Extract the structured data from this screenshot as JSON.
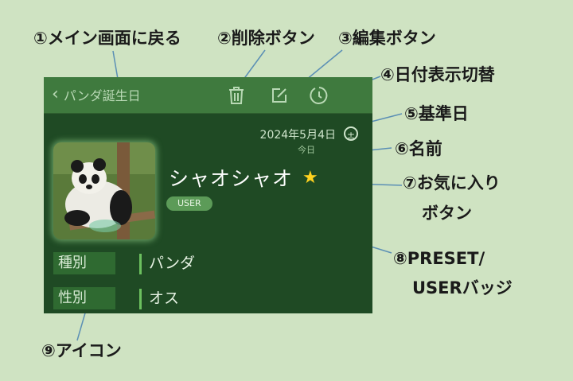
{
  "callouts": {
    "c1": "①メイン画面に戻る",
    "c2": "②削除ボタン",
    "c3": "③編集ボタン",
    "c4": "④日付表示切替",
    "c5": "⑤基準日",
    "c6": "⑥名前",
    "c7a": "⑦お気に入り",
    "c7b": "ボタン",
    "c8a": "⑧PRESET/",
    "c8b": "USERバッジ",
    "c9": "⑨アイコン"
  },
  "app": {
    "back_label": "パンダ誕生日",
    "date": "2024年5月4日",
    "today": "今日",
    "name": "シャオシャオ",
    "badge": "USER",
    "rows": [
      {
        "key": "種別",
        "value": "パンダ"
      },
      {
        "key": "性別",
        "value": "オス"
      }
    ]
  },
  "colors": {
    "background": "#cfe3c2",
    "panel": "#1f4a24",
    "topbar": "#3f7a3e",
    "star": "#ffd21f",
    "leader": "#5b8fb5"
  },
  "icons": [
    "chevron-left-icon",
    "trash-icon",
    "edit-icon",
    "clock-icon",
    "plus-minus-icon",
    "star-icon"
  ]
}
